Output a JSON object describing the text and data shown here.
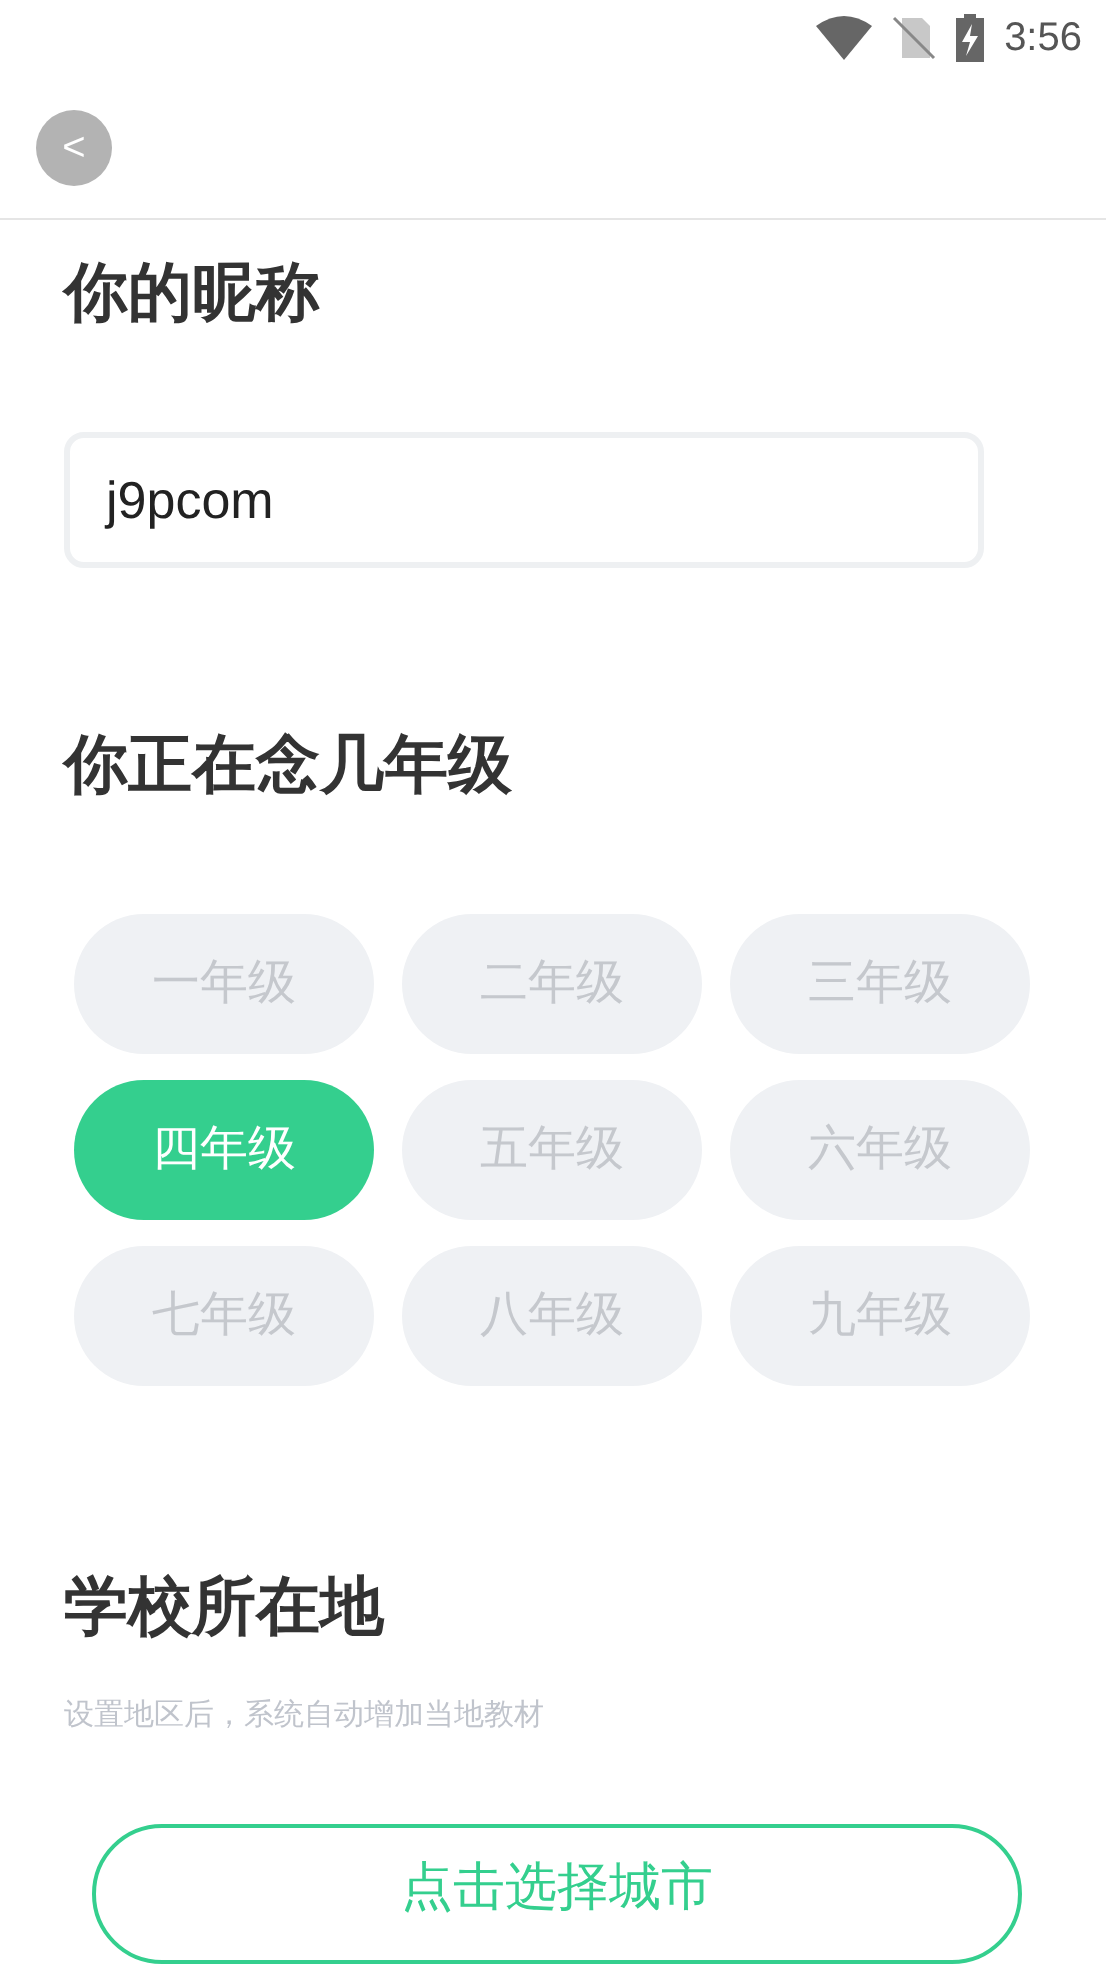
{
  "status_bar": {
    "time": "3:56"
  },
  "back_button": {
    "label": "<"
  },
  "nickname": {
    "title": "你的昵称",
    "value": "j9pcom"
  },
  "grade": {
    "title": "你正在念几年级",
    "options": [
      {
        "label": "一年级",
        "selected": false
      },
      {
        "label": "二年级",
        "selected": false
      },
      {
        "label": "三年级",
        "selected": false
      },
      {
        "label": "四年级",
        "selected": true
      },
      {
        "label": "五年级",
        "selected": false
      },
      {
        "label": "六年级",
        "selected": false
      },
      {
        "label": "七年级",
        "selected": false
      },
      {
        "label": "八年级",
        "selected": false
      },
      {
        "label": "九年级",
        "selected": false
      }
    ]
  },
  "location": {
    "title": "学校所在地",
    "hint": "设置地区后，系统自动增加当地教材",
    "button": "点击选择城市"
  }
}
